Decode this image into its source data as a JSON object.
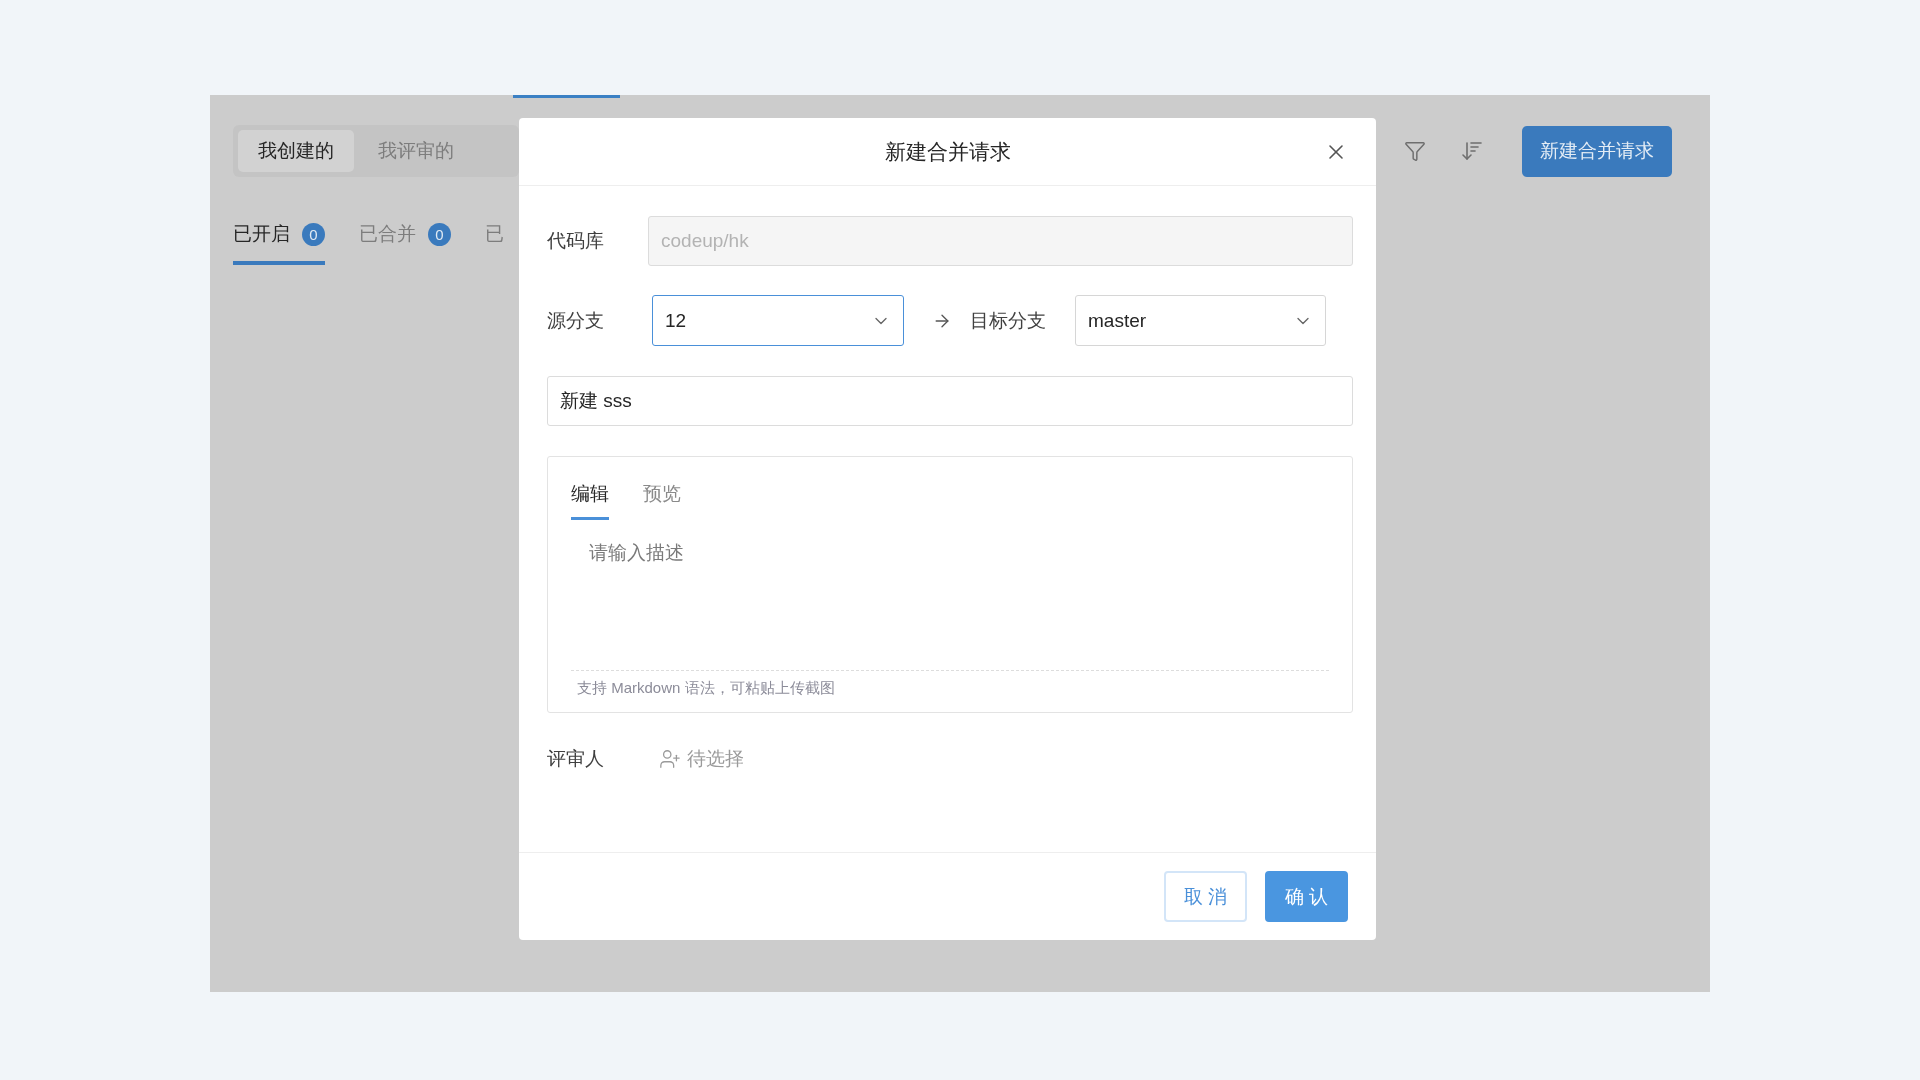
{
  "background_page": {
    "segments": [
      {
        "label": "我创建的",
        "selected": true
      },
      {
        "label": "我评审的",
        "selected": false
      }
    ],
    "status_tabs": [
      {
        "label": "已开启",
        "count": "0",
        "selected": true
      },
      {
        "label": "已合并",
        "count": "0",
        "selected": false
      },
      {
        "label": "已",
        "selected": false
      }
    ],
    "new_button": "新建合并请求"
  },
  "dialog": {
    "title": "新建合并请求",
    "repository": {
      "label": "代码库",
      "value": "codeup/hk",
      "disabled": true
    },
    "source_branch": {
      "label": "源分支",
      "value": "12",
      "focused": true
    },
    "target_branch": {
      "label": "目标分支",
      "value": "master",
      "focused": false
    },
    "title_field": {
      "value": "新建 sss"
    },
    "editor": {
      "tabs": [
        {
          "label": "编辑",
          "selected": true
        },
        {
          "label": "预览",
          "selected": false
        }
      ],
      "placeholder": "请输入描述",
      "hint": "支持 Markdown 语法，可粘贴上传截图"
    },
    "reviewer": {
      "label": "评审人",
      "placeholder": "待选择"
    },
    "buttons": {
      "cancel": "取 消",
      "confirm": "确 认"
    }
  }
}
